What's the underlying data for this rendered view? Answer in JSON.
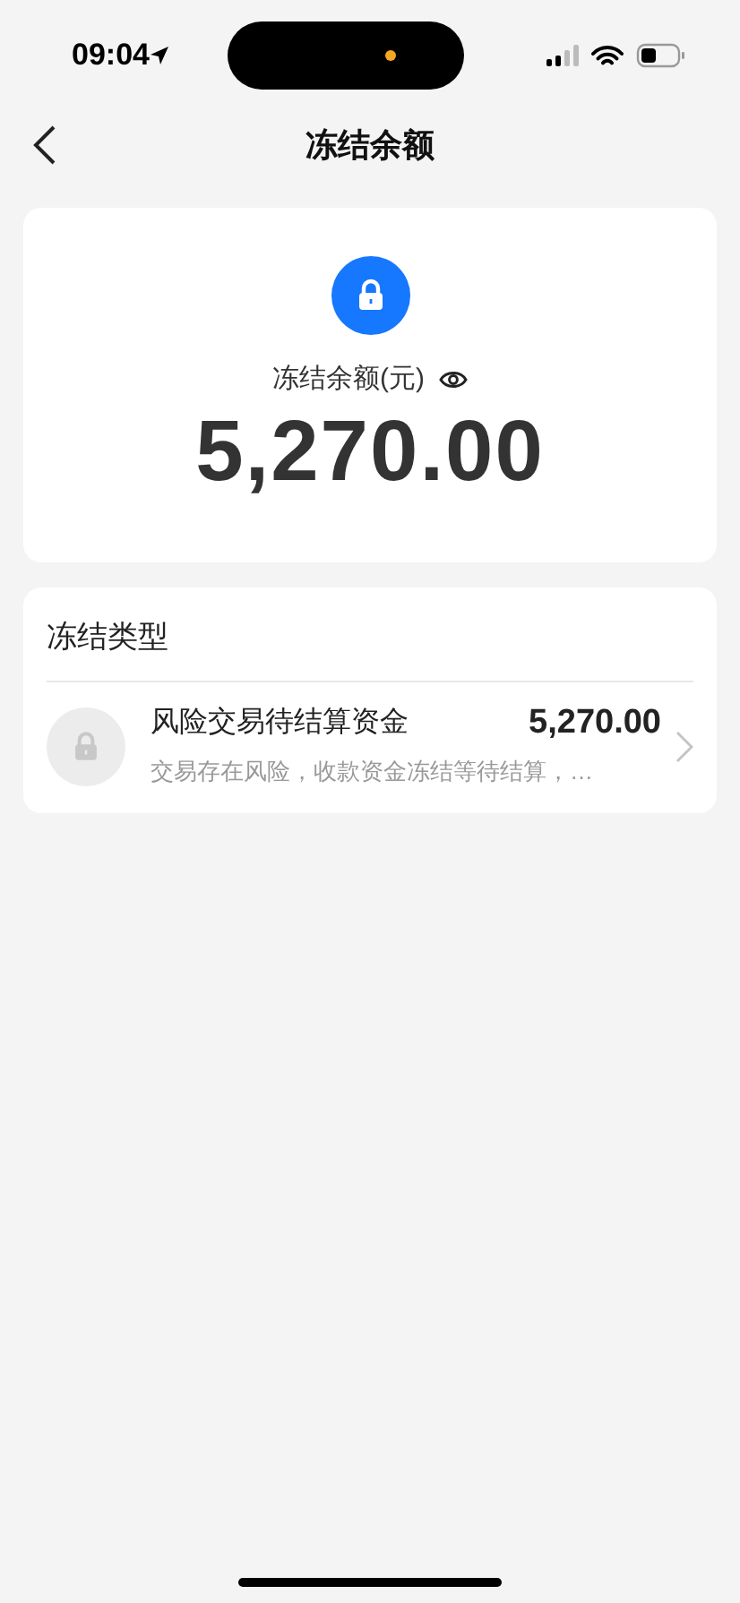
{
  "status_bar": {
    "time": "09:04"
  },
  "nav": {
    "title": "冻结余额"
  },
  "balance": {
    "label": "冻结余额(元)",
    "amount": "5,270.00"
  },
  "freeze_types": {
    "title": "冻结类型",
    "items": [
      {
        "name": "风险交易待结算资金",
        "amount": "5,270.00",
        "description": "交易存在风险，收款资金冻结等待结算，…"
      }
    ]
  }
}
